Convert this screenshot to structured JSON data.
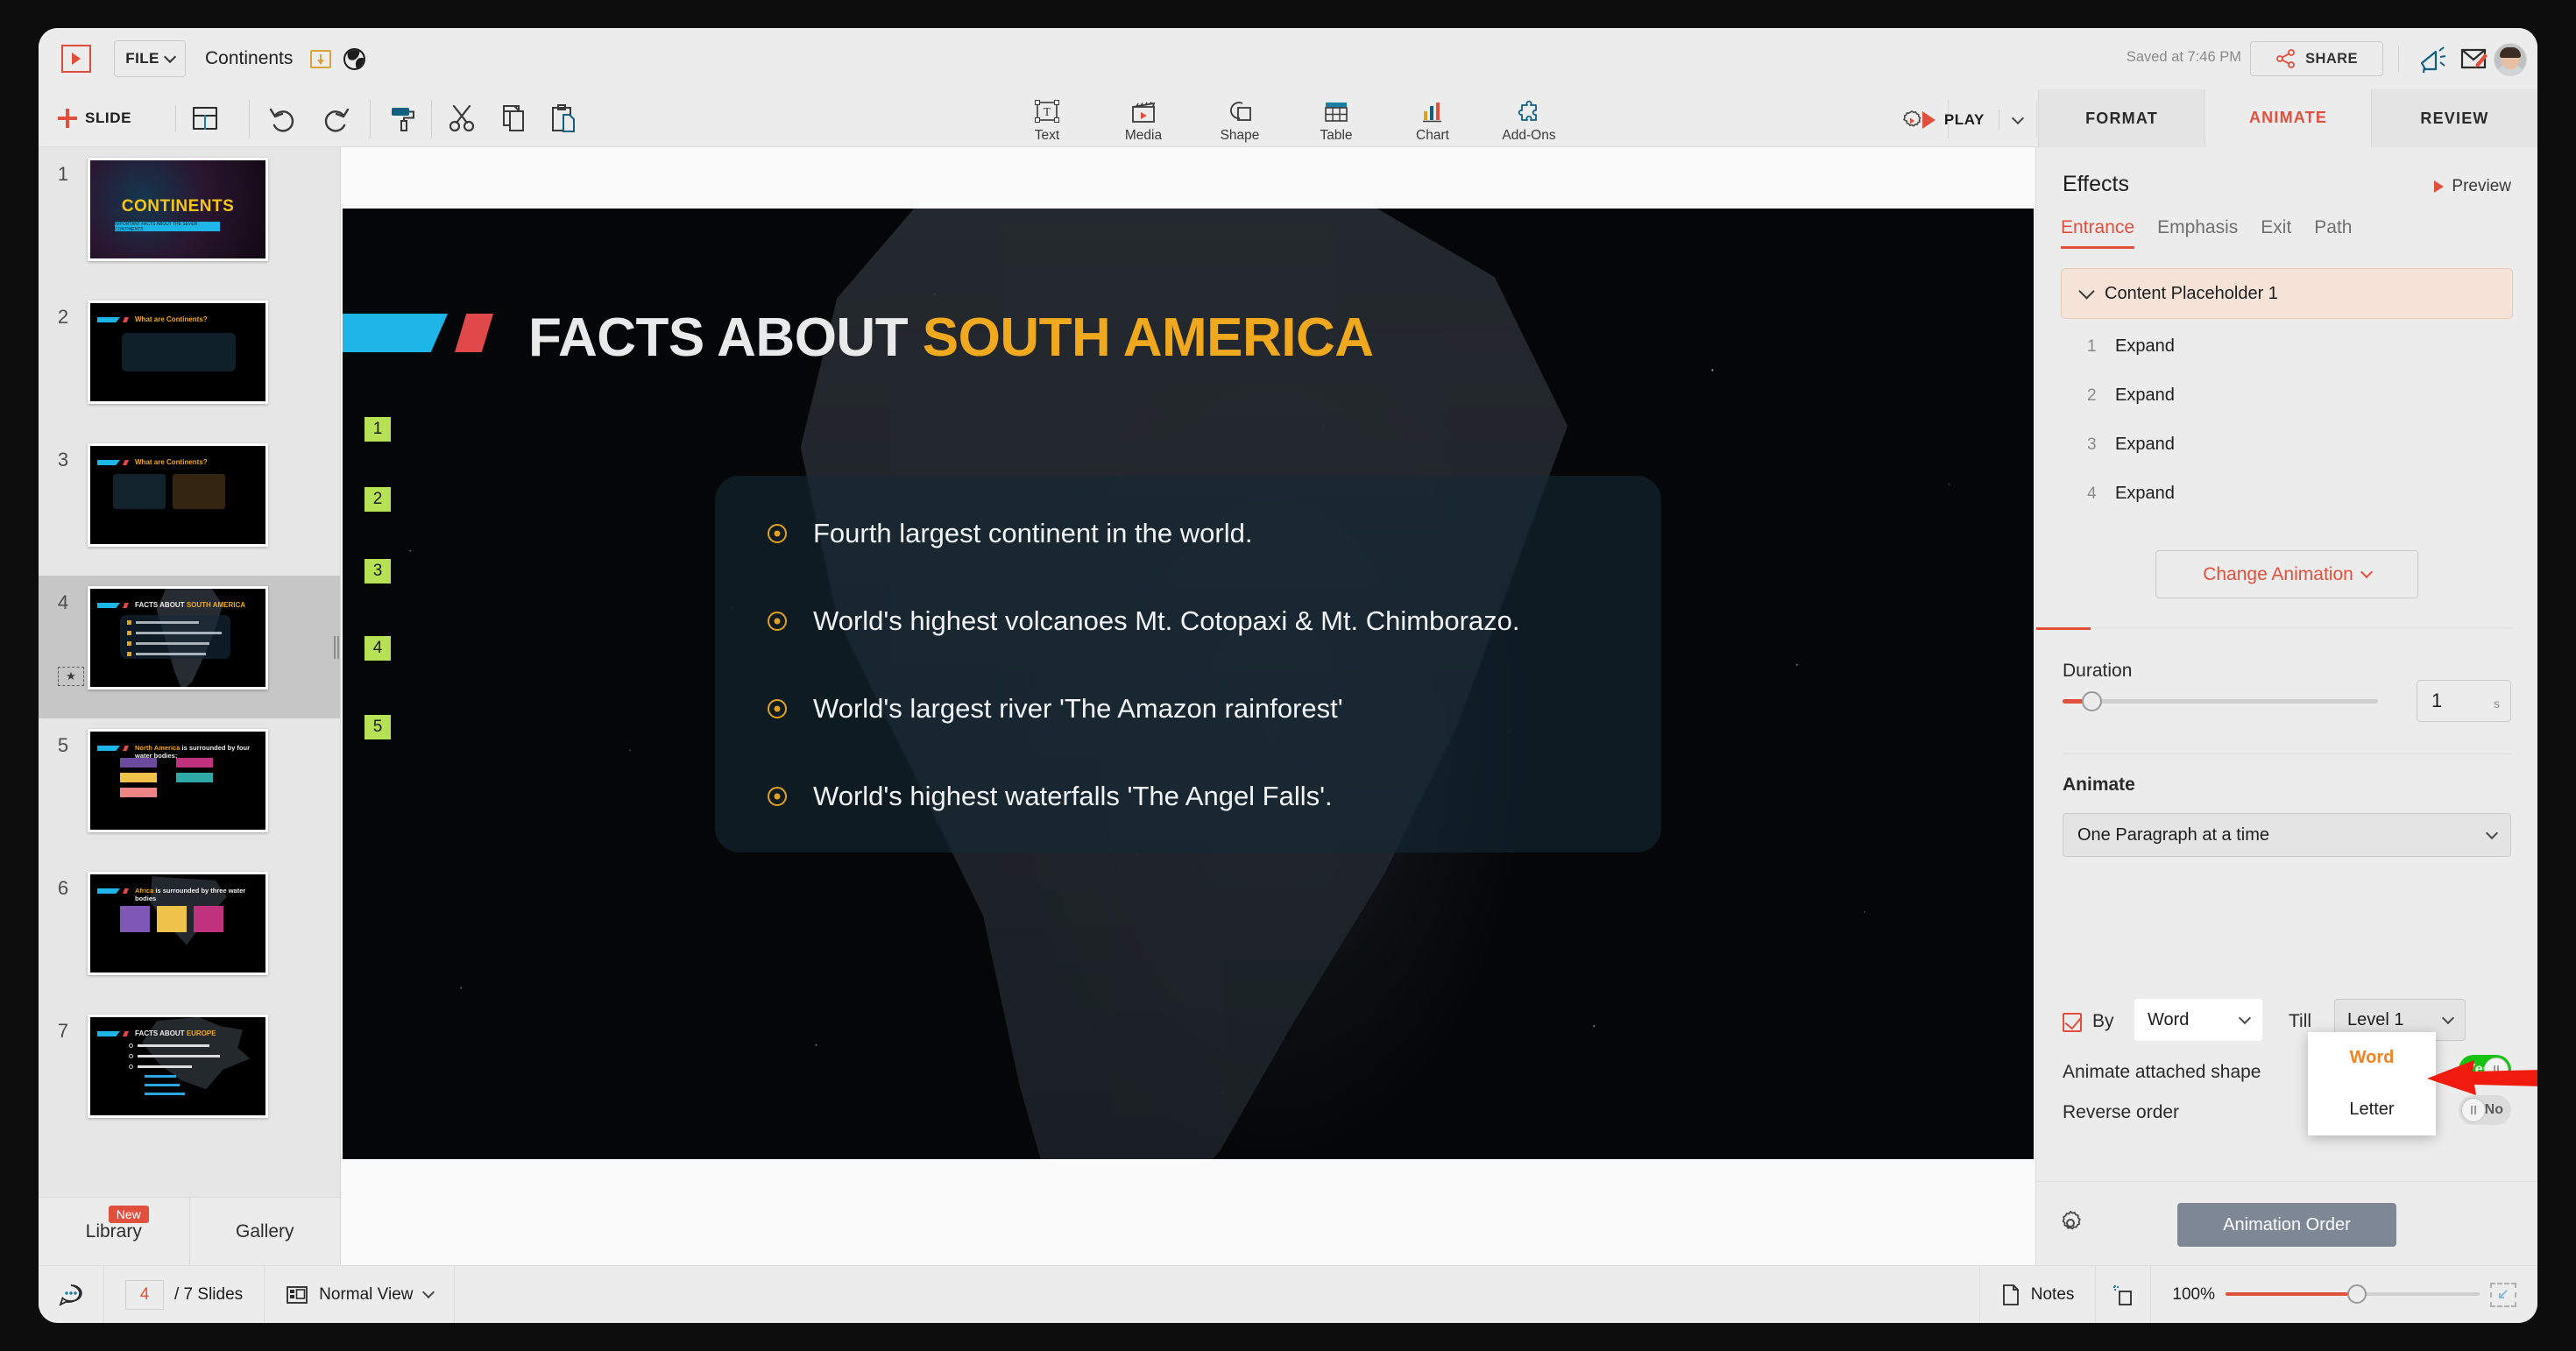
{
  "app": {
    "logo_name": "zoho-show-logo",
    "file_menu": "FILE",
    "document_title": "Continents",
    "saved_status": "Saved at 7:46 PM",
    "share_label": "SHARE"
  },
  "ribbon": {
    "add_slide_label": "SLIDE",
    "layout_icon": "slide-layout-icon",
    "tools": [
      {
        "name": "undo-icon"
      },
      {
        "name": "redo-icon"
      },
      {
        "name": "format-painter-icon"
      },
      {
        "name": "cut-icon"
      },
      {
        "name": "copy-icon"
      },
      {
        "name": "paste-icon"
      }
    ],
    "insert_tools": [
      {
        "label": "Text",
        "icon": "text-box-icon"
      },
      {
        "label": "Media",
        "icon": "media-clapper-icon"
      },
      {
        "label": "Shape",
        "icon": "shape-icon"
      },
      {
        "label": "Table",
        "icon": "table-icon"
      },
      {
        "label": "Chart",
        "icon": "chart-icon"
      },
      {
        "label": "Add-Ons",
        "icon": "puzzle-piece-icon"
      }
    ],
    "settings_icon": "gear-play-icon",
    "play_label": "PLAY",
    "tabs": [
      {
        "label": "FORMAT",
        "active": false
      },
      {
        "label": "ANIMATE",
        "active": true
      },
      {
        "label": "REVIEW",
        "active": false
      }
    ]
  },
  "thumbnails": {
    "slides": [
      {
        "number": "1",
        "title": "CONTINENTS",
        "subtitle": "IMPORTANT FACTS ABOUT THE SEVEN CONTINENTS",
        "selected": false
      },
      {
        "number": "2",
        "title": "What are Continents?",
        "selected": false
      },
      {
        "number": "3",
        "title": "What are Continents?",
        "selected": false
      },
      {
        "number": "4",
        "title": "FACTS ABOUT SOUTH AMERICA",
        "selected": true
      },
      {
        "number": "5",
        "title": "North America is surrounded by four water bodies:",
        "selected": false
      },
      {
        "number": "6",
        "title": "Africa is surrounded by three water bodies",
        "selected": false
      },
      {
        "number": "7",
        "title": "FACTS ABOUT EUROPE",
        "selected": false
      }
    ],
    "library_label": "Library",
    "library_badge": "New",
    "gallery_label": "Gallery"
  },
  "slide": {
    "title_part1": "FACTS ABOUT ",
    "title_part2": "SOUTH AMERICA",
    "bullets": [
      {
        "marker": "2",
        "text": "Fourth largest continent in the world."
      },
      {
        "marker": "3",
        "text": "World's highest volcanoes Mt. Cotopaxi & Mt. Chimborazo."
      },
      {
        "marker": "4",
        "text": "World's largest river 'The Amazon rainforest'"
      },
      {
        "marker": "5",
        "text": "World's highest waterfalls 'The Angel Falls'."
      }
    ],
    "title_marker": "1"
  },
  "effects_panel": {
    "heading": "Effects",
    "preview_label": "Preview",
    "tabs": [
      {
        "label": "Entrance",
        "active": true
      },
      {
        "label": "Emphasis",
        "active": false
      },
      {
        "label": "Exit",
        "active": false
      },
      {
        "label": "Path",
        "active": false
      }
    ],
    "placeholder_label": "Content Placeholder 1",
    "effect_items": [
      {
        "index": "1",
        "name": "Expand"
      },
      {
        "index": "2",
        "name": "Expand"
      },
      {
        "index": "3",
        "name": "Expand"
      },
      {
        "index": "4",
        "name": "Expand"
      }
    ],
    "change_animation_label": "Change Animation",
    "duration_label": "Duration",
    "duration_value": "1",
    "duration_unit": "s",
    "animate_label": "Animate",
    "animate_mode": "One Paragraph at a time",
    "by_label": "By",
    "by_value": "Word",
    "till_label": "Till",
    "till_value": "Level 1",
    "animate_shape_label": "Animate attached shape",
    "animate_shape_value": "Yes",
    "reverse_label": "Reverse order",
    "reverse_value": "No",
    "dropdown_options": [
      {
        "label": "Word",
        "selected": true
      },
      {
        "label": "Letter",
        "selected": false
      }
    ],
    "settings_icon": "gear-icon",
    "animation_order_label": "Animation Order"
  },
  "status_bar": {
    "comment_icon": "comment-icon",
    "current_slide": "4",
    "slide_count_label": "/ 7 Slides",
    "view_icon": "normal-view-icon",
    "view_label": "Normal View",
    "notes_label": "Notes",
    "fit_icon": "fit-to-slide-icon",
    "zoom_level": "100%",
    "expand_icon": "fullscreen-icon"
  },
  "colors": {
    "accent_red": "#e0503c",
    "accent_gold": "#f0a91e",
    "accent_cyan": "#1eb6e8",
    "marker_green": "#b8e255",
    "toggle_on": "#17c310",
    "dropdown_selected": "#f58220"
  }
}
